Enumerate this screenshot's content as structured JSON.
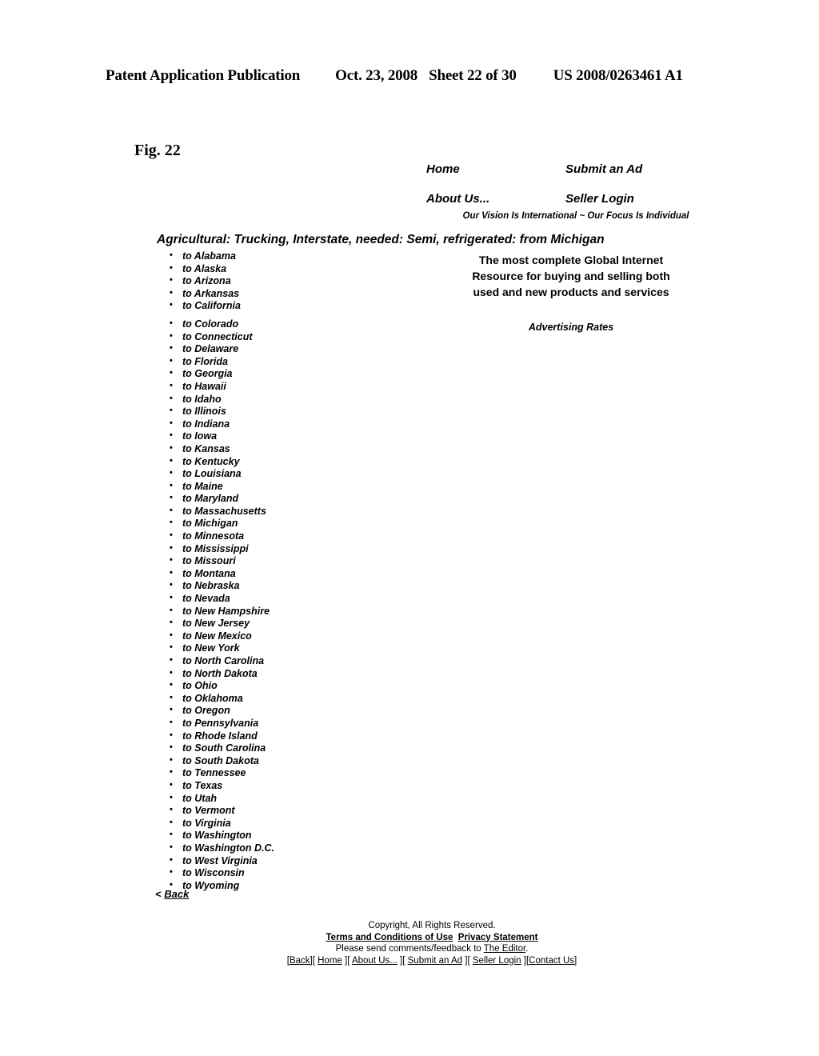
{
  "patent_header": {
    "publication": "Patent Application Publication",
    "date": "Oct. 23, 2008",
    "sheet": "Sheet 22 of 30",
    "number": "US 2008/0263461 A1"
  },
  "figure": {
    "label": "Fig. 22"
  },
  "site": {
    "nav": {
      "home": "Home",
      "submit_an_ad": "Submit an Ad",
      "about_us": "About Us...",
      "seller_login": "Seller Login"
    },
    "tagline": "Our Vision Is International ~ Our Focus Is Individual",
    "category_heading": "Agricultural: Trucking, Interstate, needed: Semi, refrigerated: from Michigan",
    "promo": "The most complete Global Internet Resource for buying and selling both used and new products and services",
    "advertising_rates": "Advertising Rates",
    "back_arrow": "<",
    "back_label": "Back",
    "states": [
      "to Alabama",
      "to Alaska",
      "to Arizona",
      "to Arkansas",
      "to California",
      "to Colorado",
      "to Connecticut",
      "to Delaware",
      "to Florida",
      "to Georgia",
      "to Hawaii",
      "to Idaho",
      "to Illinois",
      "to Indiana",
      "to Iowa",
      "to Kansas",
      "to Kentucky",
      "to Louisiana",
      "to Maine",
      "to Maryland",
      "to Massachusetts",
      "to Michigan",
      "to Minnesota",
      "to Mississippi",
      "to Missouri",
      "to Montana",
      "to Nebraska",
      "to Nevada",
      "to New Hampshire",
      "to New Jersey",
      "to New Mexico",
      "to New York",
      "to North Carolina",
      "to North Dakota",
      "to Ohio",
      "to Oklahoma",
      "to Oregon",
      "to Pennsylvania",
      "to Rhode Island",
      "to South Carolina",
      "to South Dakota",
      "to Tennessee",
      "to Texas",
      "to Utah",
      "to Vermont",
      "to Virginia",
      "to Washington",
      "to Washington D.C.",
      "to West Virginia",
      "to Wisconsin",
      "to Wyoming"
    ],
    "footer": {
      "copyright": "Copyright, All Rights Reserved.",
      "terms": "Terms and Conditions of Use",
      "privacy": "Privacy Statement",
      "feedback_prefix": "Please send comments/feedback to ",
      "feedback_link": "The Editor",
      "feedback_suffix": ".",
      "links": {
        "back": "[Back]",
        "home_open": "[ ",
        "home": "Home",
        "home_close": " ]",
        "about_open": "[ ",
        "about": "About Us...",
        "about_close": " ]",
        "submit_open": "[ ",
        "submit": "Submit an Ad",
        "submit_close": " ]",
        "seller_open": "[ ",
        "seller": "Seller Login",
        "seller_close": " ]",
        "contact": "[Contact Us]"
      }
    }
  }
}
